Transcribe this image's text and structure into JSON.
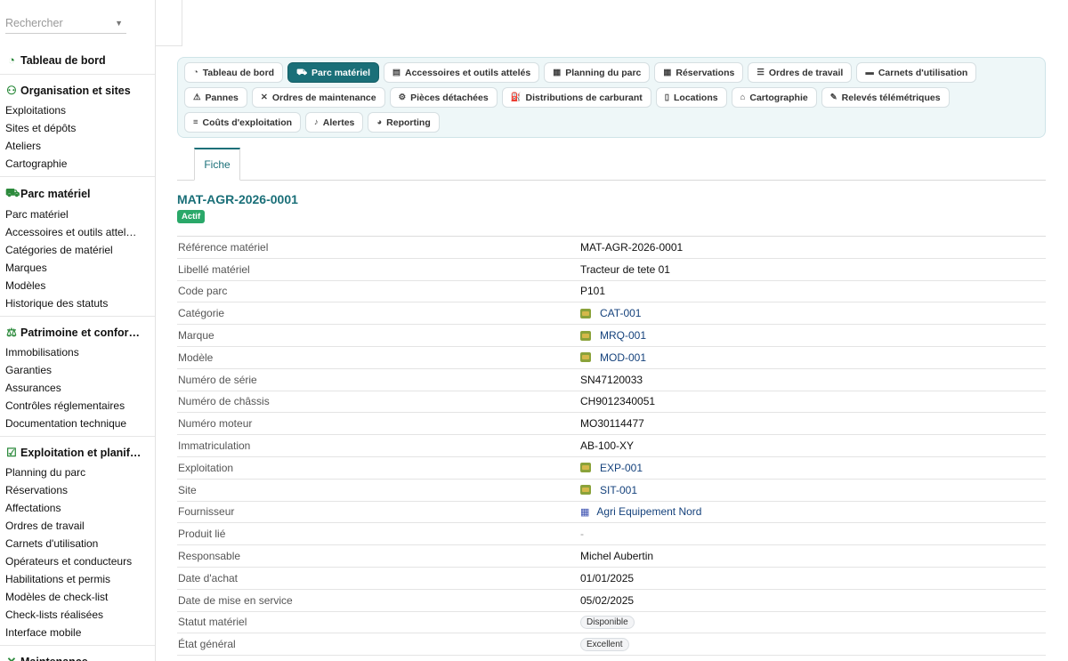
{
  "search": {
    "placeholder": "Rechercher"
  },
  "sidebar": {
    "groups": [
      {
        "title": "Tableau de bord",
        "icon": "dashboard-icon",
        "items": []
      },
      {
        "title": "Organisation et sites",
        "icon": "org-icon",
        "items": [
          "Exploitations",
          "Sites et dépôts",
          "Ateliers",
          "Cartographie"
        ]
      },
      {
        "title": "Parc matériel",
        "icon": "tractor-icon",
        "items": [
          "Parc matériel",
          "Accessoires et outils attel…",
          "Catégories de matériel",
          "Marques",
          "Modèles",
          "Historique des statuts"
        ]
      },
      {
        "title": "Patrimoine et confor…",
        "icon": "scale-icon",
        "items": [
          "Immobilisations",
          "Garanties",
          "Assurances",
          "Contrôles réglementaires",
          "Documentation technique"
        ]
      },
      {
        "title": "Exploitation et planif…",
        "icon": "checklist-icon",
        "items": [
          "Planning du parc",
          "Réservations",
          "Affectations",
          "Ordres de travail",
          "Carnets d'utilisation",
          "Opérateurs et conducteurs",
          "Habilitations et permis",
          "Modèles de check-list",
          "Check-lists réalisées",
          "Interface mobile"
        ]
      },
      {
        "title": "Maintenance",
        "icon": "wrench-icon",
        "items": []
      }
    ]
  },
  "tabs": [
    {
      "label": "Tableau de bord",
      "icon": "dashboard-icon",
      "glyph": "◔",
      "active": false
    },
    {
      "label": "Parc matériel",
      "icon": "tractor-icon",
      "glyph": "⛟",
      "active": true
    },
    {
      "label": "Accessoires et outils attelés",
      "icon": "toolbox-icon",
      "glyph": "▤",
      "active": false
    },
    {
      "label": "Planning du parc",
      "icon": "calendar-icon",
      "glyph": "▦",
      "active": false
    },
    {
      "label": "Réservations",
      "icon": "calendar-check-icon",
      "glyph": "▦",
      "active": false
    },
    {
      "label": "Ordres de travail",
      "icon": "list-icon",
      "glyph": "☰",
      "active": false
    },
    {
      "label": "Carnets d'utilisation",
      "icon": "book-icon",
      "glyph": "▬",
      "active": false
    },
    {
      "label": "Pannes",
      "icon": "warning-icon",
      "glyph": "⚠",
      "active": false
    },
    {
      "label": "Ordres de maintenance",
      "icon": "tools-icon",
      "glyph": "✕",
      "active": false
    },
    {
      "label": "Pièces détachées",
      "icon": "gear-icon",
      "glyph": "⚙",
      "active": false
    },
    {
      "label": "Distributions de carburant",
      "icon": "fuel-icon",
      "glyph": "⛽",
      "active": false
    },
    {
      "label": "Locations",
      "icon": "file-icon",
      "glyph": "▯",
      "active": false
    },
    {
      "label": "Cartographie",
      "icon": "map-icon",
      "glyph": "⌂",
      "active": false
    },
    {
      "label": "Relevés télémétriques",
      "icon": "satellite-icon",
      "glyph": "✎",
      "active": false
    },
    {
      "label": "Coûts d'exploitation",
      "icon": "coins-icon",
      "glyph": "≡",
      "active": false
    },
    {
      "label": "Alertes",
      "icon": "bell-icon",
      "glyph": "♪",
      "active": false
    },
    {
      "label": "Reporting",
      "icon": "chart-pie-icon",
      "glyph": "◕",
      "active": false
    }
  ],
  "subtab": {
    "label": "Fiche"
  },
  "record": {
    "title": "MAT-AGR-2026-0001",
    "status_badge": "Actif"
  },
  "fields": [
    {
      "label": "Référence matériel",
      "value": "MAT-AGR-2026-0001",
      "kind": "text"
    },
    {
      "label": "Libellé matériel",
      "value": "Tracteur de tete 01",
      "kind": "text"
    },
    {
      "label": "Code parc",
      "value": "P101",
      "kind": "text"
    },
    {
      "label": "Catégorie",
      "value": "CAT-001",
      "kind": "link"
    },
    {
      "label": "Marque",
      "value": "MRQ-001",
      "kind": "link"
    },
    {
      "label": "Modèle",
      "value": "MOD-001",
      "kind": "link"
    },
    {
      "label": "Numéro de série",
      "value": "SN47120033",
      "kind": "text"
    },
    {
      "label": "Numéro de châssis",
      "value": "CH9012340051",
      "kind": "text"
    },
    {
      "label": "Numéro moteur",
      "value": "MO30114477",
      "kind": "text"
    },
    {
      "label": "Immatriculation",
      "value": "AB-100-XY",
      "kind": "text"
    },
    {
      "label": "Exploitation",
      "value": "EXP-001",
      "kind": "link"
    },
    {
      "label": "Site",
      "value": "SIT-001",
      "kind": "link"
    },
    {
      "label": "Fournisseur",
      "value": "Agri Equipement Nord",
      "kind": "building-link"
    },
    {
      "label": "Produit lié",
      "value": "-",
      "kind": "dash"
    },
    {
      "label": "Responsable",
      "value": "Michel Aubertin",
      "kind": "text"
    },
    {
      "label": "Date d'achat",
      "value": "01/01/2025",
      "kind": "text"
    },
    {
      "label": "Date de mise en service",
      "value": "05/02/2025",
      "kind": "text"
    },
    {
      "label": "Statut matériel",
      "value": "Disponible",
      "kind": "pill"
    },
    {
      "label": "État général",
      "value": "Excellent",
      "kind": "pill"
    }
  ]
}
